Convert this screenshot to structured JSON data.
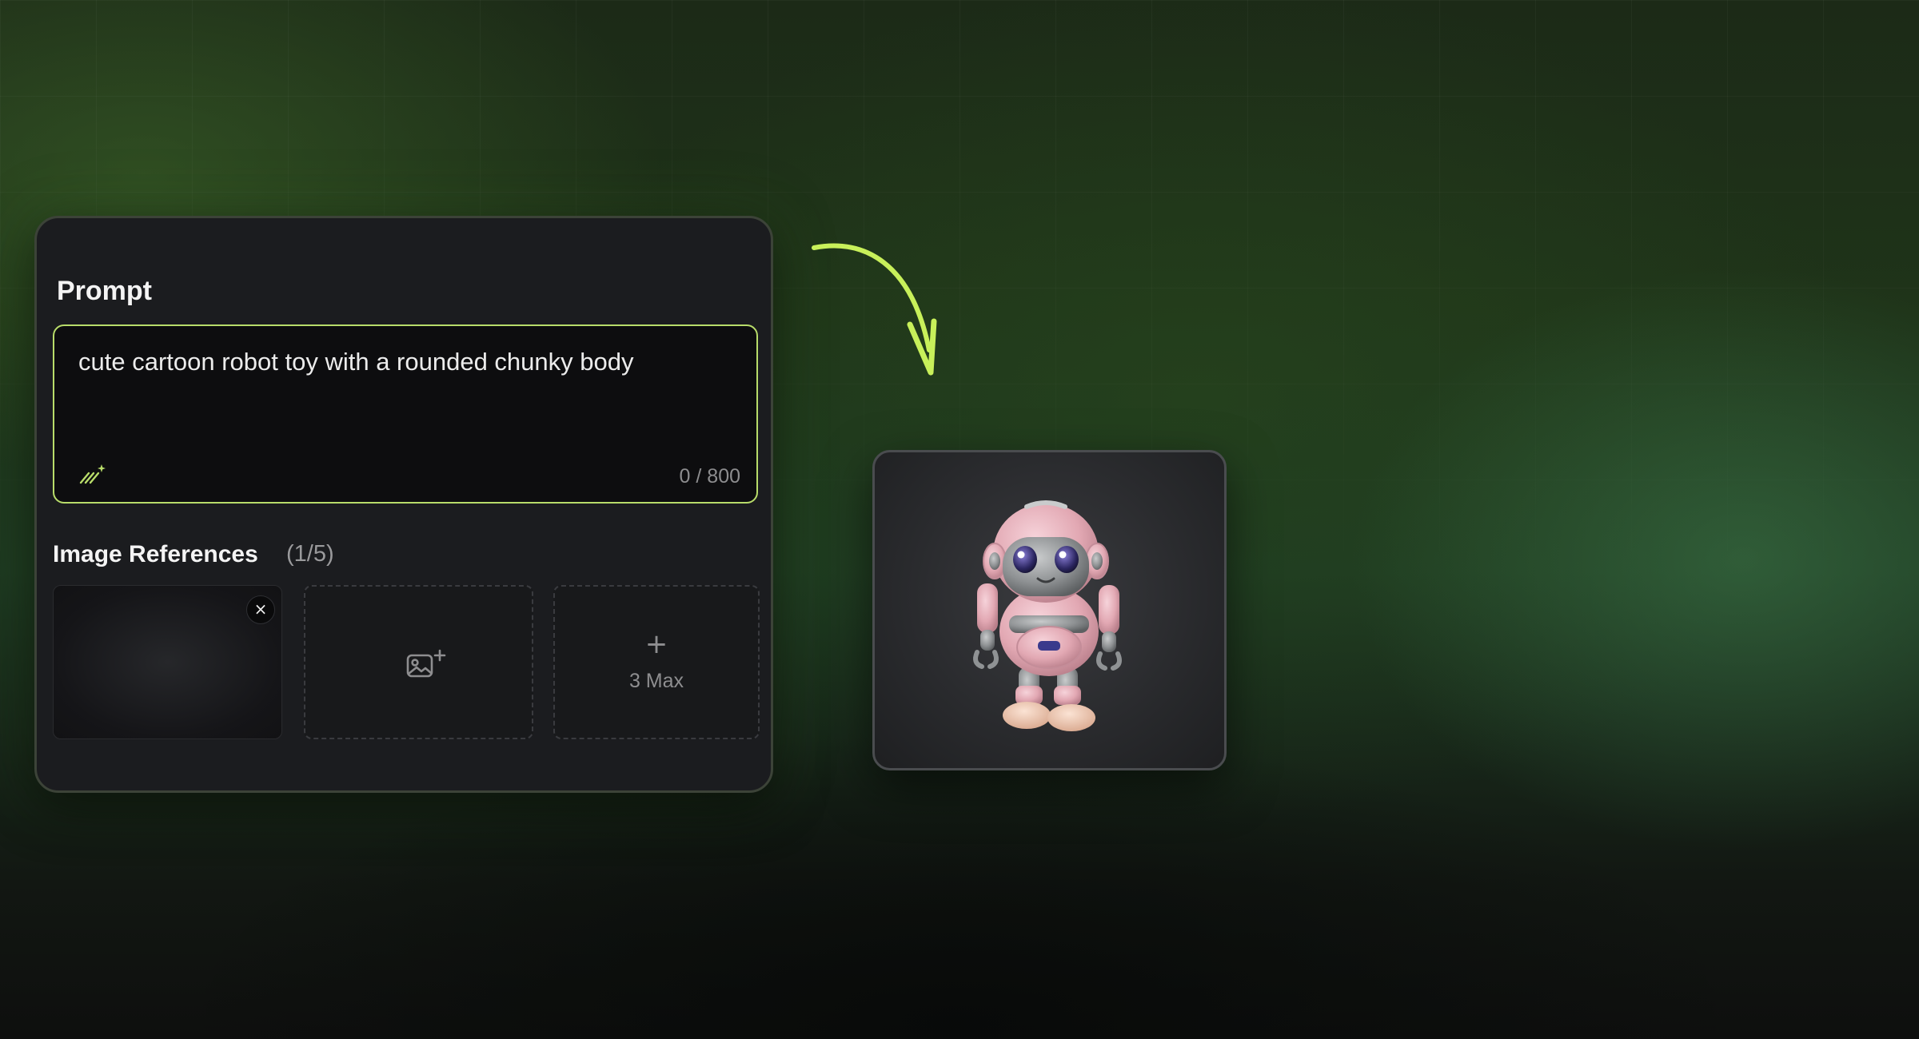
{
  "prompt_panel": {
    "title": "Prompt",
    "prompt_value": "cute cartoon robot toy with a rounded chunky body",
    "char_count": "0 / 800",
    "magic_icon": "magic-wand-icon"
  },
  "image_references": {
    "title": "Image References",
    "count": "(1/5)",
    "remove_icon": "close-icon",
    "remove_glyph": "×",
    "add_image_icon": "image-plus-icon",
    "max_slot": {
      "glyph": "+",
      "label": "3 Max"
    }
  },
  "result": {
    "preview": "robot-toy-3d-model"
  },
  "colors": {
    "accent": "#b8dc6a",
    "arrow": "#c8f05a",
    "panel_bg": "#1b1c1f"
  }
}
